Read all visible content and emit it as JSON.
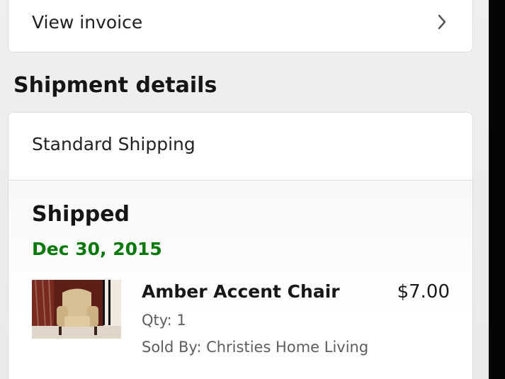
{
  "invoice": {
    "label": "View invoice",
    "icon": "chevron-right-icon"
  },
  "shipment": {
    "section_title": "Shipment details",
    "shipping_type": "Standard Shipping",
    "status": "Shipped",
    "date": "Dec 30, 2015",
    "status_color": "#08780b",
    "item": {
      "title": "Amber Accent Chair",
      "price": "$7.00",
      "quantity": "Qty: 1",
      "seller": "Sold By: Christies Home Living",
      "image_icon": "accent-chair-product-image"
    }
  }
}
